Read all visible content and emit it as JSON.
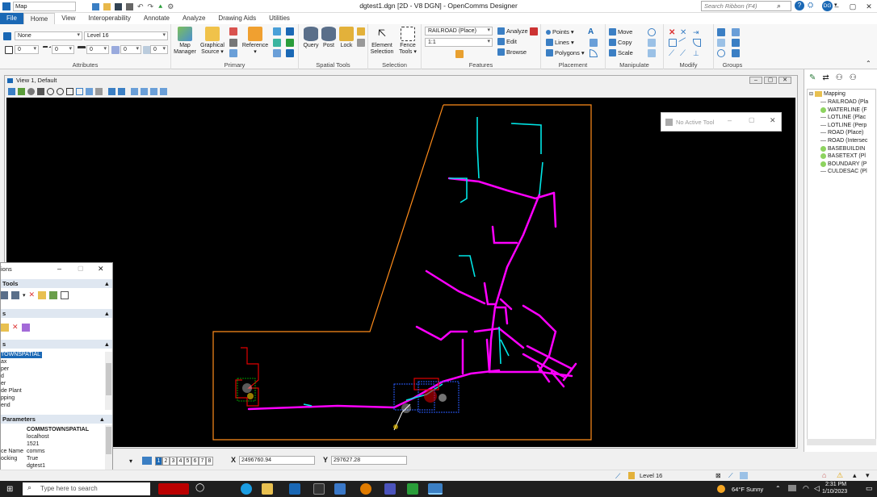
{
  "window": {
    "app_label": "Map",
    "title": "dgtest1.dgn [2D - V8 DGN] - OpenComms Designer",
    "search_placeholder": "Search Ribbon (F4)",
    "user_initials": "DG"
  },
  "tabs": [
    "File",
    "Home",
    "View",
    "Interoperability",
    "Annotate",
    "Analyze",
    "Drawing Aids",
    "Utilities"
  ],
  "ribbon": {
    "attributes": {
      "label": "Attributes",
      "color_value": "None",
      "level_value": "Level 16",
      "style_value": "0",
      "weight_value": "0",
      "trans_value": "0",
      "pri_value": "0",
      "class_value": "0"
    },
    "primary": {
      "label": "Primary",
      "map_manager": "Map Manager",
      "graphical_source": "Graphical Source ▾",
      "reference": "Reference ▾"
    },
    "spatial_tools": {
      "label": "Spatial Tools",
      "query": "Query",
      "post": "Post",
      "lock": "Lock"
    },
    "selection": {
      "label": "Selection",
      "element_selection": "Element Selection",
      "fence_tools": "Fence Tools ▾"
    },
    "features": {
      "label": "Features",
      "feature_value": "RAILROAD (Place)",
      "scale_value": "1:1",
      "analyze": "Analyze",
      "edit": "Edit",
      "browse": "Browse"
    },
    "placement": {
      "label": "Placement",
      "points": "Points ▾",
      "lines": "Lines ▾",
      "polygons": "Polygons ▾"
    },
    "manipulate": {
      "label": "Manipulate",
      "move": "Move",
      "copy": "Copy",
      "scale": "Scale"
    },
    "modify": {
      "label": "Modify"
    },
    "groups": {
      "label": "Groups"
    }
  },
  "view": {
    "title": "View 1, Default"
  },
  "no_active_tool": "No Active Tool",
  "explorer": {
    "header_title": "ions",
    "section_tools": "Tools",
    "section_s": "s",
    "section_s2": "s",
    "selected_item": "TOWNSPATIAL",
    "list_items": [
      "ax",
      "per",
      "d",
      "er",
      "de Plant",
      "pping",
      "end"
    ],
    "params_header": "Parameters",
    "params": [
      {
        "key": "",
        "value": "COMMSTOWNSPATIAL"
      },
      {
        "key": "",
        "value": "localhost"
      },
      {
        "key": "",
        "value": "1521"
      },
      {
        "key": "ce Name",
        "value": "comms"
      },
      {
        "key": "ocking",
        "value": "True"
      },
      {
        "key": "",
        "value": "dgtest1"
      }
    ]
  },
  "tree": {
    "root": "Mapping",
    "items": [
      "RAILROAD (Pla",
      "WATERLINE (F",
      "LOTLINE (Plac",
      "LOTLINE (Perp",
      "ROAD (Place)",
      "ROAD (Intersec",
      "BASEBUILDIN",
      "BASETEXT (Pl",
      "BOUNDARY (P",
      "CULDESAC (Pl"
    ]
  },
  "status": {
    "view_numbers": [
      "1",
      "2",
      "3",
      "4",
      "5",
      "6",
      "7",
      "8"
    ],
    "x_label": "X",
    "x_value": "2496760.94",
    "y_label": "Y",
    "y_value": "297627.28",
    "level": "Level 16"
  },
  "taskbar": {
    "search": "Type here to search",
    "weather": "64°F  Sunny",
    "time": "2:31 PM",
    "date": "1/10/2023"
  },
  "colors": {
    "accent": "#1a68b5",
    "magenta": "#ff00ff",
    "cyan": "#00e5e5",
    "orange": "#ff8c1a"
  }
}
